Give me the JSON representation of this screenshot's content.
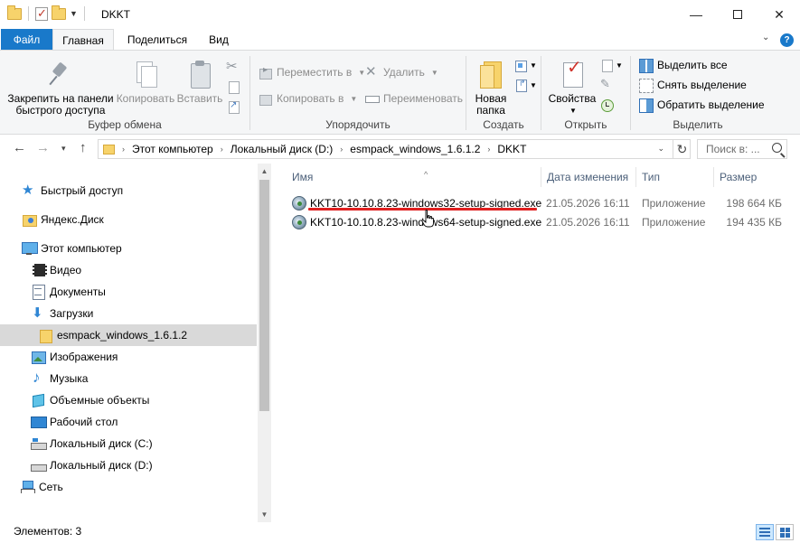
{
  "window": {
    "title": "DKKT",
    "controls": {
      "minimize": "—",
      "maximize": "",
      "close": "✕"
    }
  },
  "ribbon_tabs": [
    {
      "label": "Файл"
    },
    {
      "label": "Главная"
    },
    {
      "label": "Поделиться"
    },
    {
      "label": "Вид"
    }
  ],
  "ribbon": {
    "clipboard": {
      "label": "Буфер обмена",
      "pin_line1": "Закрепить на панели",
      "pin_line2": "быстрого доступа",
      "copy": "Копировать",
      "paste": "Вставить"
    },
    "organize": {
      "label": "Упорядочить",
      "move_to": "Переместить в",
      "copy_to": "Копировать в",
      "delete": "Удалить",
      "rename": "Переименовать"
    },
    "create": {
      "label": "Создать",
      "new_folder_line1": "Новая",
      "new_folder_line2": "папка"
    },
    "open": {
      "label": "Открыть",
      "properties": "Свойства"
    },
    "select": {
      "label": "Выделить",
      "select_all": "Выделить все",
      "select_none": "Снять выделение",
      "invert": "Обратить выделение"
    }
  },
  "address": {
    "crumbs": [
      "Этот компьютер",
      "Локальный диск (D:)",
      "esmpack_windows_1.6.1.2",
      "DKKT"
    ],
    "search_placeholder": "Поиск в: ..."
  },
  "navpane": {
    "items": [
      {
        "label": "Быстрый доступ",
        "icon": "star-icon"
      },
      {
        "label": "Яндекс.Диск",
        "icon": "yandex-disk-icon"
      },
      {
        "label": "Этот компьютер",
        "icon": "computer-icon"
      },
      {
        "label": "Видео",
        "icon": "video-icon"
      },
      {
        "label": "Документы",
        "icon": "documents-icon"
      },
      {
        "label": "Загрузки",
        "icon": "downloads-icon"
      },
      {
        "label": "esmpack_windows_1.6.1.2",
        "icon": "folder-icon"
      },
      {
        "label": "Изображения",
        "icon": "images-icon"
      },
      {
        "label": "Музыка",
        "icon": "music-icon"
      },
      {
        "label": "Объемные объекты",
        "icon": "3d-objects-icon"
      },
      {
        "label": "Рабочий стол",
        "icon": "desktop-icon"
      },
      {
        "label": "Локальный диск (C:)",
        "icon": "drive-icon"
      },
      {
        "label": "Локальный диск (D:)",
        "icon": "drive-icon"
      },
      {
        "label": "Сеть",
        "icon": "network-icon"
      }
    ]
  },
  "filelist": {
    "columns": [
      "Имя",
      "Дата изменения",
      "Тип",
      "Размер"
    ],
    "rows": [
      {
        "name": "KKT10-10.10.8.23-windows32-setup-signed.exe",
        "date": "21.05.2026 16:11",
        "type": "Приложение",
        "size": "198 664 КБ"
      },
      {
        "name": "KKT10-10.10.8.23-windows64-setup-signed.exe",
        "date": "21.05.2026 16:11",
        "type": "Приложение",
        "size": "194 435 КБ"
      }
    ]
  },
  "status": {
    "items_count": "Элементов: 3"
  },
  "colors": {
    "accent": "#1979ca",
    "selection": "#d9d9d9",
    "annotation_underline": "#e02020"
  }
}
